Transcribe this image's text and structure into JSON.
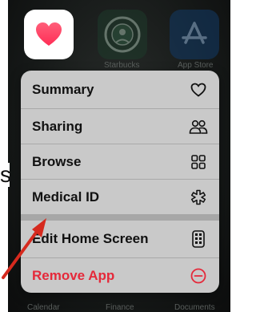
{
  "home_screen": {
    "starbucks_label": "Starbucks",
    "appstore_label": "App Store",
    "bottom_labels": [
      "Calendar",
      "Finance",
      "Documents"
    ],
    "partial_text": "s"
  },
  "menu": {
    "items": [
      {
        "label": "Summary",
        "icon": "heart-outline-icon"
      },
      {
        "label": "Sharing",
        "icon": "people-icon"
      },
      {
        "label": "Browse",
        "icon": "grid-icon"
      },
      {
        "label": "Medical ID",
        "icon": "medical-asterisk-icon"
      }
    ],
    "secondary_items": [
      {
        "label": "Edit Home Screen",
        "icon": "phone-apps-icon"
      },
      {
        "label": "Remove App",
        "icon": "minus-circle-icon"
      }
    ]
  },
  "colors": {
    "menu_bg": "#c9c9c9",
    "destructive": "#e5293a",
    "health_heart": "#ff2d55",
    "annotation_arrow": "#d62a1e"
  }
}
